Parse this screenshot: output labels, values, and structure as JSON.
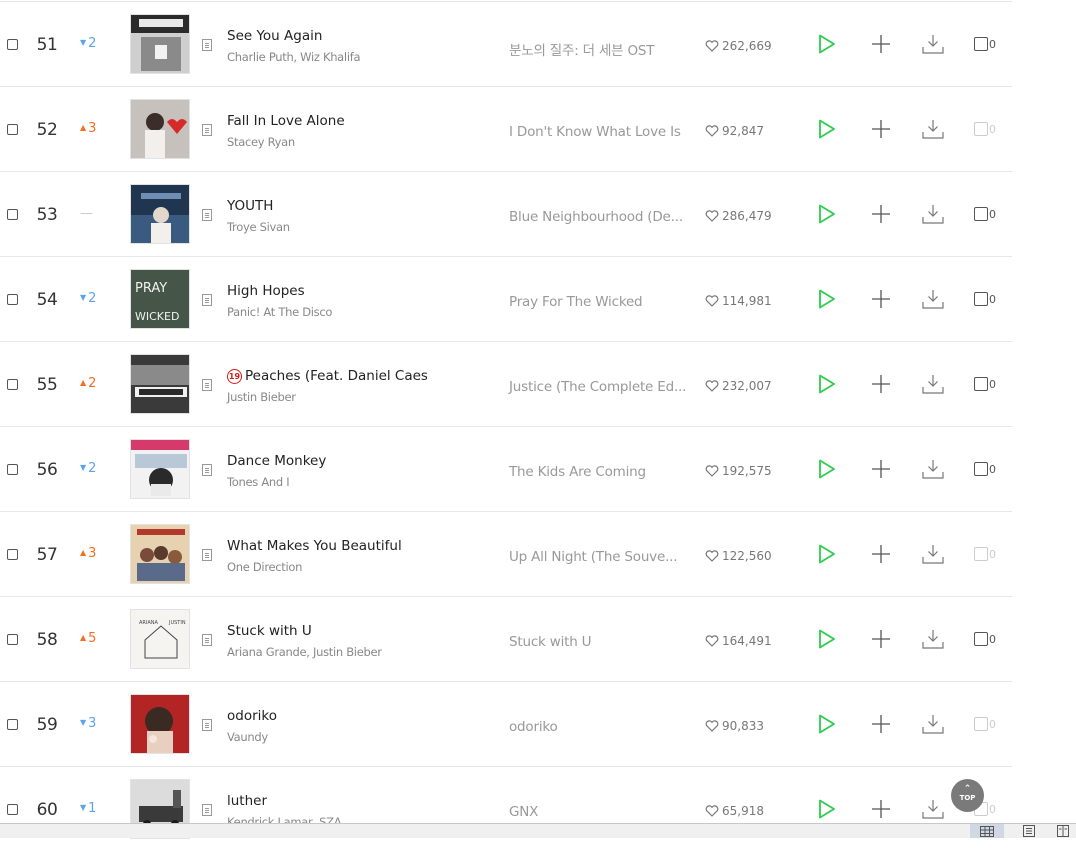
{
  "rows": [
    {
      "rank": "51",
      "change": "2",
      "dir": "down",
      "title": "See You Again",
      "artist": "Charlie Puth, Wiz Khalifa",
      "album": "분노의 질주: 더 세븐 OST",
      "likes": "262,669",
      "video": "0",
      "video_enabled": true,
      "age_restricted": false
    },
    {
      "rank": "52",
      "change": "3",
      "dir": "up",
      "title": "Fall In Love Alone",
      "artist": "Stacey Ryan",
      "album": "I Don't Know What Love Is",
      "likes": "92,847",
      "video": "0",
      "video_enabled": false,
      "age_restricted": false
    },
    {
      "rank": "53",
      "change": "",
      "dir": "static",
      "title": "YOUTH",
      "artist": "Troye Sivan",
      "album": "Blue Neighbourhood (De...",
      "likes": "286,479",
      "video": "0",
      "video_enabled": true,
      "age_restricted": false
    },
    {
      "rank": "54",
      "change": "2",
      "dir": "down",
      "title": "High Hopes",
      "artist": "Panic! At The Disco",
      "album": "Pray For The Wicked",
      "likes": "114,981",
      "video": "0",
      "video_enabled": true,
      "age_restricted": false
    },
    {
      "rank": "55",
      "change": "2",
      "dir": "up",
      "title": "Peaches (Feat. Daniel Caes...",
      "artist": "Justin Bieber",
      "album": "Justice (The Complete Ed...",
      "likes": "232,007",
      "video": "0",
      "video_enabled": true,
      "age_restricted": true,
      "age_label": "19"
    },
    {
      "rank": "56",
      "change": "2",
      "dir": "down",
      "title": "Dance Monkey",
      "artist": "Tones And I",
      "album": "The Kids Are Coming",
      "likes": "192,575",
      "video": "0",
      "video_enabled": true,
      "age_restricted": false
    },
    {
      "rank": "57",
      "change": "3",
      "dir": "up",
      "title": "What Makes You Beautiful",
      "artist": "One Direction",
      "album": "Up All Night (The Souve...",
      "likes": "122,560",
      "video": "0",
      "video_enabled": false,
      "age_restricted": false
    },
    {
      "rank": "58",
      "change": "5",
      "dir": "up",
      "title": "Stuck with U",
      "artist": "Ariana Grande, Justin Bieber",
      "album": "Stuck with U",
      "likes": "164,491",
      "video": "0",
      "video_enabled": true,
      "age_restricted": false
    },
    {
      "rank": "59",
      "change": "3",
      "dir": "down",
      "title": "odoriko",
      "artist": "Vaundy",
      "album": "odoriko",
      "likes": "90,833",
      "video": "0",
      "video_enabled": false,
      "age_restricted": false
    },
    {
      "rank": "60",
      "change": "1",
      "dir": "down",
      "title": "luther",
      "artist": "Kendrick Lamar, SZA",
      "album": "GNX",
      "likes": "65,918",
      "video": "0",
      "video_enabled": false,
      "age_restricted": false
    }
  ],
  "top_button": {
    "label": "TOP"
  },
  "colors": {
    "play": "#2ecc4f",
    "rank_up": "#f26e22",
    "rank_down": "#5ba3eb",
    "static": "#c9c9c9",
    "age_badge": "#d21d1d"
  },
  "icons": [
    "heart-icon",
    "play-icon",
    "plus-icon",
    "download-icon",
    "lyrics-icon",
    "chevron-up-icon",
    "grid-view-icon",
    "list-view-icon",
    "page-view-icon"
  ]
}
